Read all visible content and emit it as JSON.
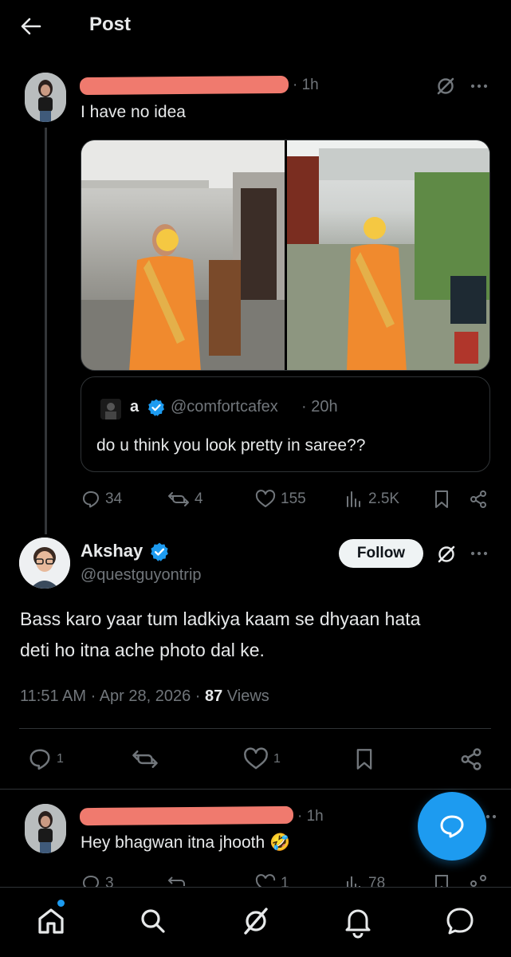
{
  "header": {
    "title": "Post"
  },
  "parent_post": {
    "time": "· 1h",
    "text": "I have no idea",
    "quoted": {
      "name": "a",
      "handle": "@comfortcafex",
      "time": "· 20h",
      "text": "do u think you look pretty in saree??"
    },
    "stats": {
      "replies": "34",
      "reposts": "4",
      "likes": "155",
      "views": "2.5K"
    }
  },
  "main_post": {
    "name": "Akshay",
    "handle": "@questguyontrip",
    "follow_label": "Follow",
    "text_line1": "Bass karo yaar tum ladkiya kaam se dhyaan hata",
    "text_line2": "deti ho itna ache photo dal ke.",
    "timestamp": "11:51 AM · Apr 28, 2026 · ",
    "views_count": "87",
    "views_label": " Views",
    "stats": {
      "replies": "1",
      "likes": "1"
    }
  },
  "reply_post": {
    "time": "· 1h",
    "text": "Hey bhagwan itna jhooth 🤣",
    "stats": {
      "replies": "3",
      "likes": "1",
      "views": "78"
    }
  },
  "colors": {
    "accent": "#1d9bf0",
    "background": "#000000",
    "muted": "#71767b",
    "redaction": "#f07a6e"
  },
  "icons": [
    "back-arrow-icon",
    "grok-icon",
    "more-icon",
    "verified-badge-icon",
    "reply-icon",
    "repost-icon",
    "like-icon",
    "views-icon",
    "bookmark-icon",
    "share-icon",
    "compose-icon",
    "home-icon",
    "search-icon",
    "grok-nav-icon",
    "notifications-icon",
    "messages-icon"
  ]
}
